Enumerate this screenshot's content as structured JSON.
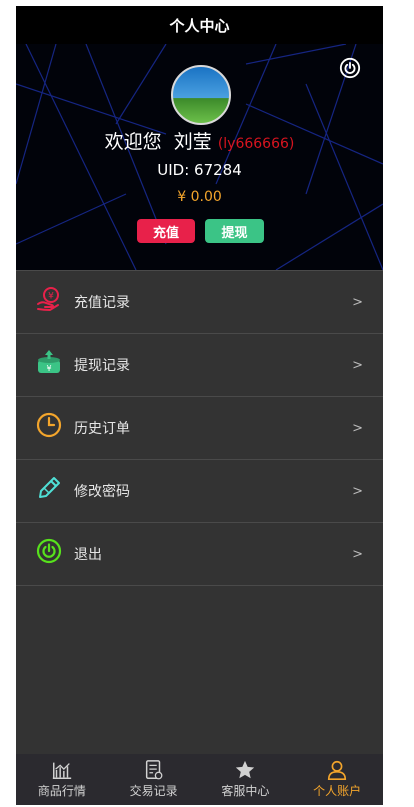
{
  "header": {
    "title": "个人中心"
  },
  "profile": {
    "welcome": "欢迎您",
    "name": "刘莹",
    "account": "(ly666666)",
    "uid": "UID:  67284",
    "balance": "¥ 0.00",
    "recharge_label": "充值",
    "withdraw_label": "提现"
  },
  "menu": [
    {
      "label": "充值记录",
      "icon": "recharge-record-icon",
      "arrow": ">"
    },
    {
      "label": "提现记录",
      "icon": "withdraw-record-icon",
      "arrow": ">"
    },
    {
      "label": "历史订单",
      "icon": "clock-icon",
      "arrow": ">"
    },
    {
      "label": "修改密码",
      "icon": "pencil-icon",
      "arrow": ">"
    },
    {
      "label": "退出",
      "icon": "power-icon",
      "arrow": ">"
    }
  ],
  "tabs": [
    {
      "label": "商品行情",
      "icon": "chart-icon"
    },
    {
      "label": "交易记录",
      "icon": "document-icon"
    },
    {
      "label": "客服中心",
      "icon": "star-icon"
    },
    {
      "label": "个人账户",
      "icon": "user-icon",
      "active": true
    }
  ],
  "colors": {
    "accent": "#f3a52c",
    "recharge": "#e8214a",
    "withdraw": "#3bc486",
    "account": "#d7141f"
  }
}
